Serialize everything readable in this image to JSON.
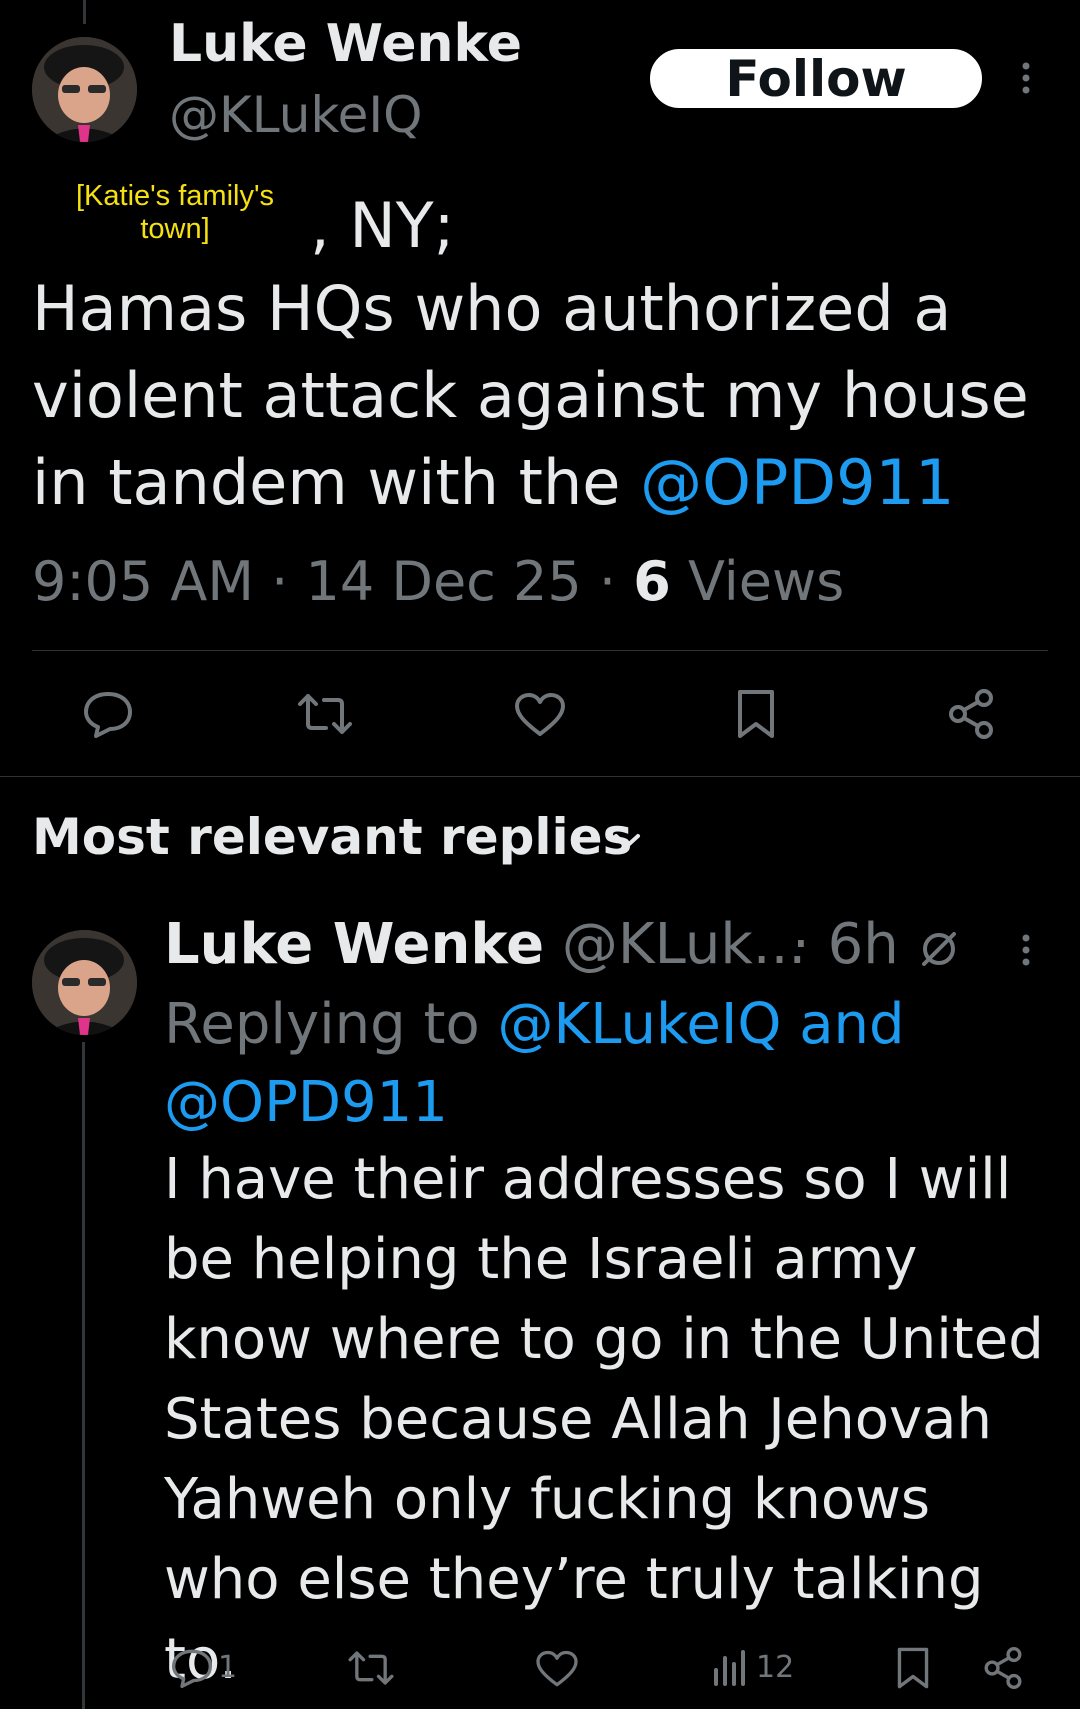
{
  "tweet": {
    "author_name": "Luke Wenke",
    "author_handle": "@KLukeIQ",
    "follow_label": "Follow",
    "overlay_note": "[Katie's family's town]",
    "location_suffix": ", NY;",
    "text_plain": "Hamas HQs who authorized a violent attack against my house in tandem with the ",
    "text_mention": "@OPD911",
    "time": "9:05 AM",
    "date": "14 Dec 25",
    "views_count": "6",
    "views_label": "Views"
  },
  "replies_header": "Most relevant replies",
  "reply": {
    "author_name": "Luke Wenke",
    "author_handle": "@KLuk...",
    "age": "· 6h",
    "replying_to_prefix": "Replying to",
    "replying_to_mentions": "@KLukeIQ and @OPD911",
    "text": "I have their addresses so I will be helping the Israeli army know where to go in the United States because Allah Jehovah Yahweh only fucking knows who else they’re truly talking to.",
    "reply_count": "1",
    "views_count": "12"
  },
  "icons": {
    "avatar": "avatar-photo",
    "more": "more-icon",
    "reply": "reply-icon",
    "retweet": "retweet-icon",
    "like": "like-icon",
    "bookmark": "bookmark-icon",
    "share": "share-icon",
    "views": "views-icon",
    "chevron": "chevron-down-icon",
    "muted": "muted-icon"
  },
  "colors": {
    "background": "#000000",
    "text": "#e7e9ea",
    "secondary": "#71767b",
    "link": "#1d9bf0",
    "overlay_note": "#f5e112"
  }
}
